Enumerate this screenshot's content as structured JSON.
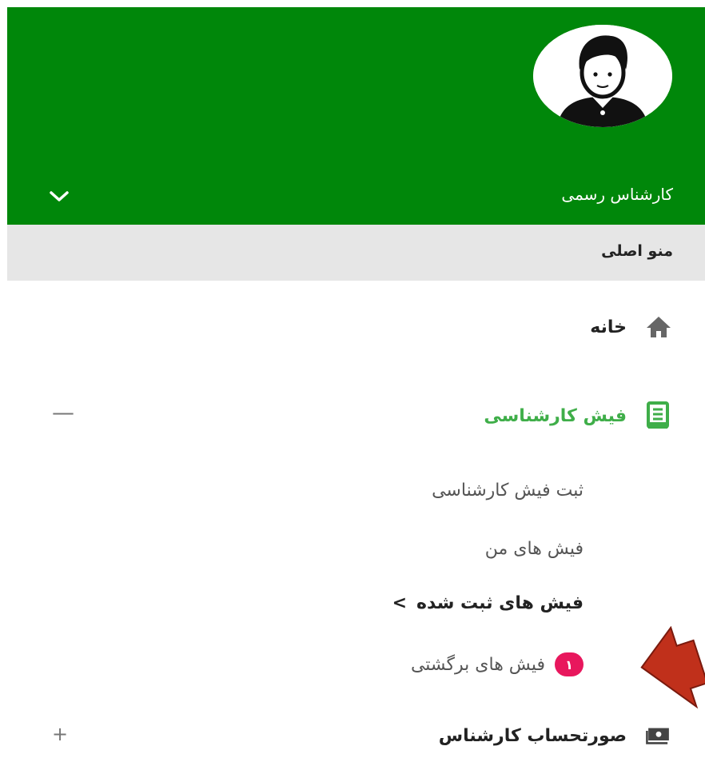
{
  "header": {
    "user_role": "کارشناس رسمی",
    "bg_color": "#00870a"
  },
  "menu": {
    "section_title": "منو اصلی",
    "items": [
      {
        "label": "خانه",
        "icon": "home-icon"
      },
      {
        "label": "فیش کارشناسی",
        "icon": "receipt-icon",
        "toggle": "—",
        "active_color": "#3fae49"
      },
      {
        "label": "صورتحساب کارشناس",
        "icon": "invoice-icon",
        "toggle": "+"
      }
    ],
    "sub_items": [
      {
        "label": "ثبت فیش کارشناسی"
      },
      {
        "label": "فیش های من"
      },
      {
        "label": "فیش های ثبت شده",
        "chevron": ">"
      },
      {
        "label": "فیش های برگشتی",
        "badge": "۱"
      }
    ]
  },
  "annotation": {
    "arrow_color": "#c0301b"
  }
}
